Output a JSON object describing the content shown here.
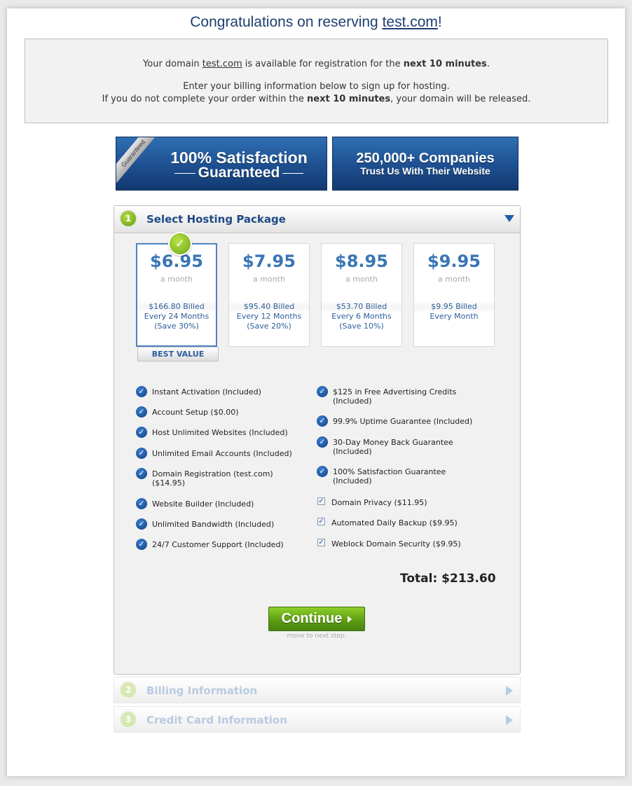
{
  "header": {
    "title_prefix": "Congratulations on reserving ",
    "domain": "test.com",
    "title_suffix": "!"
  },
  "notice": {
    "line1_a": "Your domain ",
    "line1_domain": "test.com",
    "line1_b": " is available for registration for the ",
    "line1_bold": "next 10 minutes",
    "line1_c": ".",
    "line2": "Enter your billing information below to sign up for hosting.",
    "line3_a": "If you do not complete your order within the ",
    "line3_bold": "next 10 minutes",
    "line3_b": ", your domain will be released."
  },
  "banners": {
    "guarantee_ribbon": "Guaranteed",
    "guarantee_line1": "100% Satisfaction",
    "guarantee_line2": "Guaranteed",
    "companies_line1": "250,000+ Companies",
    "companies_line2": "Trust Us With Their Website"
  },
  "step1": {
    "number": "1",
    "title": "Select Hosting Package",
    "selected_mark": "✓",
    "best_value": "BEST VALUE",
    "plans": [
      {
        "price": "$6.95",
        "per": "a month",
        "bill1": "$166.80 Billed",
        "bill2": "Every 24 Months",
        "bill3": "(Save 30%)",
        "selected": true
      },
      {
        "price": "$7.95",
        "per": "a month",
        "bill1": "$95.40 Billed",
        "bill2": "Every 12 Months",
        "bill3": "(Save 20%)",
        "selected": false
      },
      {
        "price": "$8.95",
        "per": "a month",
        "bill1": "$53.70 Billed",
        "bill2": "Every 6 Months",
        "bill3": "(Save 10%)",
        "selected": false
      },
      {
        "price": "$9.95",
        "per": "a month",
        "bill1": "$9.95 Billed",
        "bill2": "Every Month",
        "bill3": "",
        "selected": false
      }
    ],
    "features_left": [
      {
        "line1": "Instant Activation (Included)",
        "line2": ""
      },
      {
        "line1": "Account Setup ($0.00)",
        "line2": ""
      },
      {
        "line1": "Host Unlimited Websites (Included)",
        "line2": ""
      },
      {
        "line1": "Unlimited Email Accounts (Included)",
        "line2": ""
      },
      {
        "line1": "Domain Registration (test.com)",
        "line2": "($14.95)"
      },
      {
        "line1": "Website Builder (Included)",
        "line2": ""
      },
      {
        "line1": "Unlimited Bandwidth (Included)",
        "line2": ""
      },
      {
        "line1": "24/7 Customer Support (Included)",
        "line2": ""
      }
    ],
    "features_right": [
      {
        "line1": "$125 in Free Advertising Credits",
        "line2": "(Included)"
      },
      {
        "line1": "99.9% Uptime Guarantee (Included)",
        "line2": ""
      },
      {
        "line1": "30-Day Money Back Guarantee",
        "line2": "(Included)"
      },
      {
        "line1": "100% Satisfaction Guarantee",
        "line2": "(Included)"
      }
    ],
    "addons": [
      {
        "label": "Domain Privacy ($11.95)",
        "checked": true
      },
      {
        "label": "Automated Daily Backup ($9.95)",
        "checked": true
      },
      {
        "label": "Weblock Domain Security ($9.95)",
        "checked": true
      }
    ],
    "total": "Total: $213.60",
    "continue_label": "Continue",
    "continue_hint": "move to next step."
  },
  "step2": {
    "number": "2",
    "title": "Billing Information"
  },
  "step3": {
    "number": "3",
    "title": "Credit Card Information"
  },
  "colors": {
    "accent": "#1e4a85",
    "go_green": "#5a9a12",
    "link_blue": "#3a76b6"
  }
}
